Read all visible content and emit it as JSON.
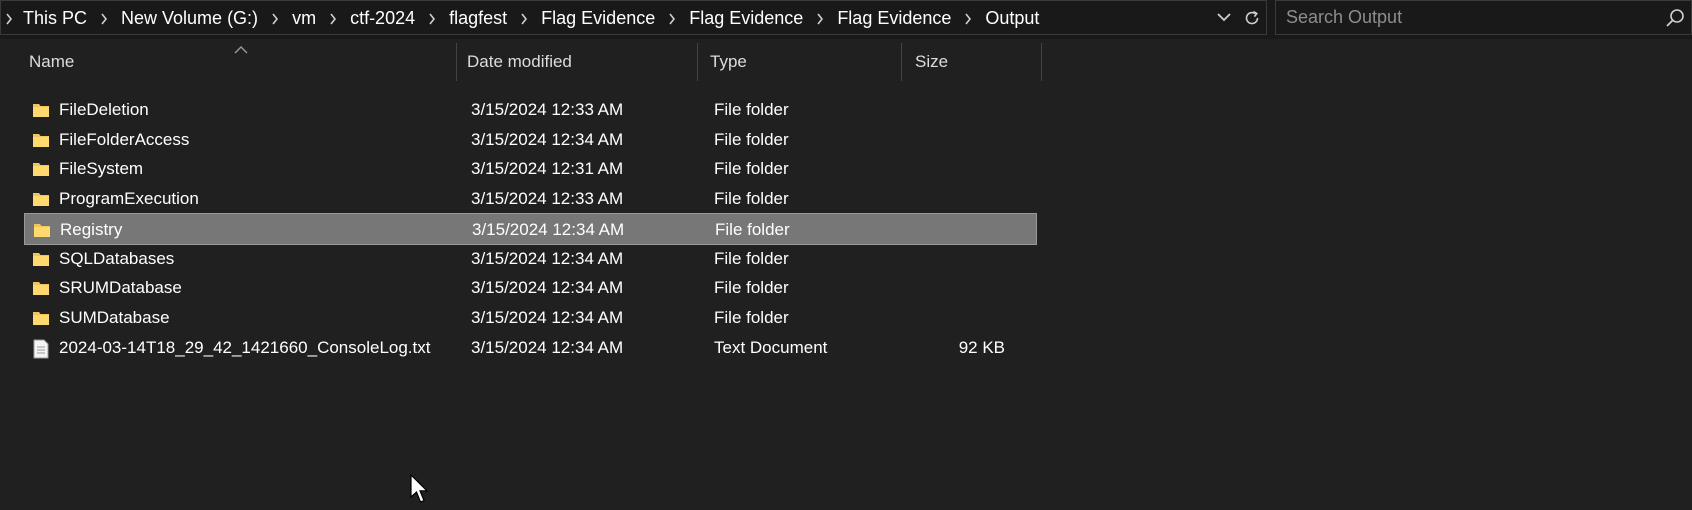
{
  "address_bar": {
    "breadcrumbs": [
      "This PC",
      "New Volume (G:)",
      "vm",
      "ctf-2024",
      "flagfest",
      "Flag Evidence",
      "Flag Evidence",
      "Flag Evidence",
      "Output"
    ]
  },
  "search": {
    "placeholder": "Search Output"
  },
  "columns": {
    "name": "Name",
    "date": "Date modified",
    "type": "Type",
    "size": "Size"
  },
  "files": [
    {
      "name": "FileDeletion",
      "date": "3/15/2024 12:33 AM",
      "type": "File folder",
      "size": "",
      "icon": "folder-icon"
    },
    {
      "name": "FileFolderAccess",
      "date": "3/15/2024 12:34 AM",
      "type": "File folder",
      "size": "",
      "icon": "folder-icon"
    },
    {
      "name": "FileSystem",
      "date": "3/15/2024 12:31 AM",
      "type": "File folder",
      "size": "",
      "icon": "folder-icon"
    },
    {
      "name": "ProgramExecution",
      "date": "3/15/2024 12:33 AM",
      "type": "File folder",
      "size": "",
      "icon": "folder-icon"
    },
    {
      "name": "Registry",
      "date": "3/15/2024 12:34 AM",
      "type": "File folder",
      "size": "",
      "icon": "folder-icon",
      "selected": true
    },
    {
      "name": "SQLDatabases",
      "date": "3/15/2024 12:34 AM",
      "type": "File folder",
      "size": "",
      "icon": "folder-icon"
    },
    {
      "name": "SRUMDatabase",
      "date": "3/15/2024 12:34 AM",
      "type": "File folder",
      "size": "",
      "icon": "folder-icon"
    },
    {
      "name": "SUMDatabase",
      "date": "3/15/2024 12:34 AM",
      "type": "File folder",
      "size": "",
      "icon": "folder-icon"
    },
    {
      "name": "2024-03-14T18_29_42_1421660_ConsoleLog.txt",
      "date": "3/15/2024 12:34 AM",
      "type": "Text Document",
      "size": "92 KB",
      "icon": "text-document-icon"
    }
  ],
  "colors": {
    "background": "#202020",
    "selection": "#777777",
    "folder": "#f2c55c"
  }
}
